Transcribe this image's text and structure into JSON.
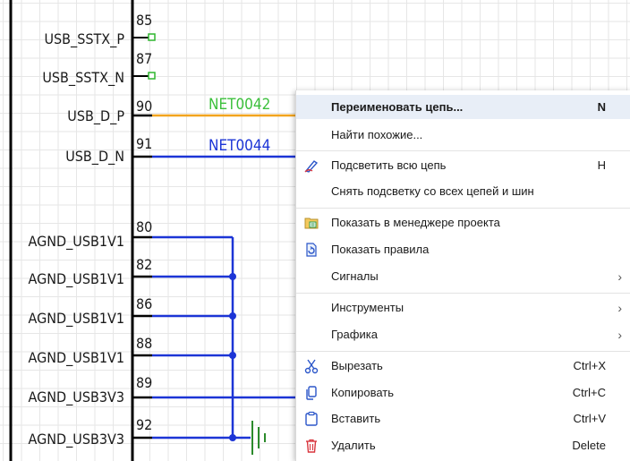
{
  "schematic": {
    "pins": [
      {
        "name": "USB_SSTX_P",
        "number": "85"
      },
      {
        "name": "USB_SSTX_N",
        "number": "87"
      },
      {
        "name": "USB_D_P",
        "number": "90"
      },
      {
        "name": "USB_D_N",
        "number": "91"
      },
      {
        "name": "AGND_USB1V1",
        "number": "80"
      },
      {
        "name": "AGND_USB1V1",
        "number": "82"
      },
      {
        "name": "AGND_USB1V1",
        "number": "86"
      },
      {
        "name": "AGND_USB1V1",
        "number": "88"
      },
      {
        "name": "AGND_USB3V3",
        "number": "89"
      },
      {
        "name": "AGND_USB3V3",
        "number": "92"
      }
    ],
    "net_labels": [
      {
        "text": "NET0042",
        "color": "#3cc03c"
      },
      {
        "text": "NET0044",
        "color": "#1c35d6"
      }
    ],
    "colors": {
      "orange_wire": "#f2a41e",
      "blue_wire": "#1c35d6",
      "ground": "#2c8a2c",
      "body": "#000000"
    }
  },
  "context_menu": {
    "items": [
      {
        "label": "Переименовать цепь...",
        "shortcut": "N",
        "icon": "",
        "submenu": false
      },
      {
        "label": "Найти похожие...",
        "shortcut": "",
        "icon": "",
        "submenu": false
      },
      {
        "label": "Подсветить всю цепь",
        "shortcut": "H",
        "icon": "highlight-pen-icon",
        "submenu": false
      },
      {
        "label": "Снять подсветку со всех цепей и шин",
        "shortcut": "",
        "icon": "",
        "submenu": false
      },
      {
        "label": "Показать в менеджере проекта",
        "shortcut": "",
        "icon": "project-manager-icon",
        "submenu": false
      },
      {
        "label": "Показать правила",
        "shortcut": "",
        "icon": "rules-icon",
        "submenu": false
      },
      {
        "label": "Сигналы",
        "shortcut": "",
        "icon": "",
        "submenu": true
      },
      {
        "label": "Инструменты",
        "shortcut": "",
        "icon": "",
        "submenu": true
      },
      {
        "label": "Графика",
        "shortcut": "",
        "icon": "",
        "submenu": true
      },
      {
        "label": "Вырезать",
        "shortcut": "Ctrl+X",
        "icon": "scissors-icon",
        "submenu": false
      },
      {
        "label": "Копировать",
        "shortcut": "Ctrl+C",
        "icon": "copy-icon",
        "submenu": false
      },
      {
        "label": "Вставить",
        "shortcut": "Ctrl+V",
        "icon": "paste-icon",
        "submenu": false
      },
      {
        "label": "Удалить",
        "shortcut": "Delete",
        "icon": "trash-icon",
        "submenu": false
      }
    ],
    "submenu_arrow": "›"
  }
}
